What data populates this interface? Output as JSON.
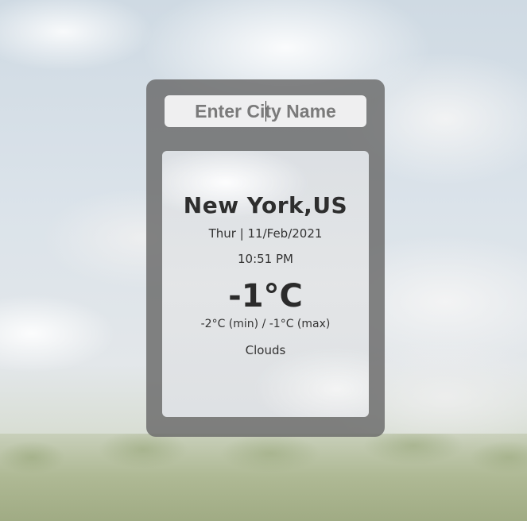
{
  "search": {
    "placeholder": "Enter City Name",
    "value": ""
  },
  "weather": {
    "city": "New York,US",
    "date": "Thur | 11/Feb/2021",
    "time": "10:51 PM",
    "temperature": "-1°C",
    "min_max": "-2°C (min) / -1°C (max)",
    "condition": "Clouds"
  },
  "colors": {
    "card_bg": "#696969",
    "text": "#2b2b2b",
    "placeholder": "#7a7a7a"
  }
}
